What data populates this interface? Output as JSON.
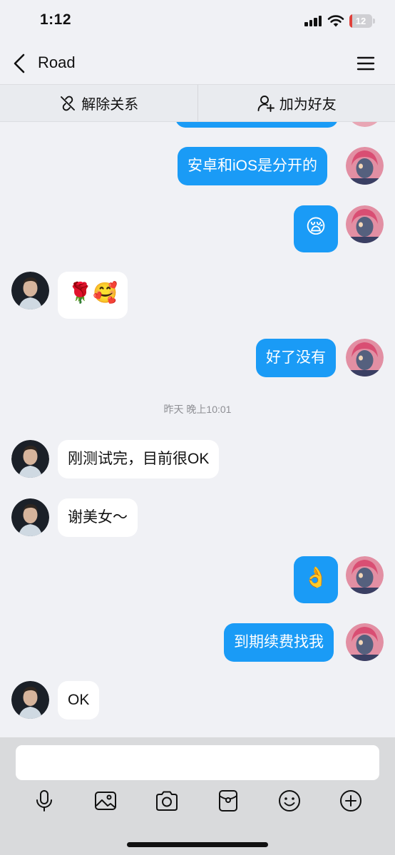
{
  "status_bar": {
    "time": "1:12",
    "battery": "12",
    "battery_level": 0.12
  },
  "nav": {
    "title": "Road"
  },
  "actions": {
    "remove_label": "解除关系",
    "add_label": "加为好友"
  },
  "messages": [
    {
      "side": "out",
      "text": "安卓和iOS是分开的"
    },
    {
      "side": "out",
      "emoji": "😪"
    },
    {
      "side": "in",
      "emoji": "🌹🥰"
    },
    {
      "side": "out",
      "text": "好了没有"
    },
    {
      "side": "in",
      "text": "刚测试完，目前很OK"
    },
    {
      "side": "in",
      "text": "谢美女～"
    },
    {
      "side": "out",
      "emoji": "👌"
    },
    {
      "side": "out",
      "text": "到期续费找我"
    },
    {
      "side": "in",
      "text": "OK"
    }
  ],
  "timestamp": "昨天 晚上10:01",
  "input": {
    "placeholder": ""
  },
  "toolbar_icons": [
    "microphone-icon",
    "image-icon",
    "camera-icon",
    "red-packet-icon",
    "emoji-icon",
    "plus-icon"
  ],
  "colors": {
    "outgoing_bubble": "#1a9bf6",
    "incoming_bubble": "#ffffff",
    "background": "#f0f1f5"
  }
}
